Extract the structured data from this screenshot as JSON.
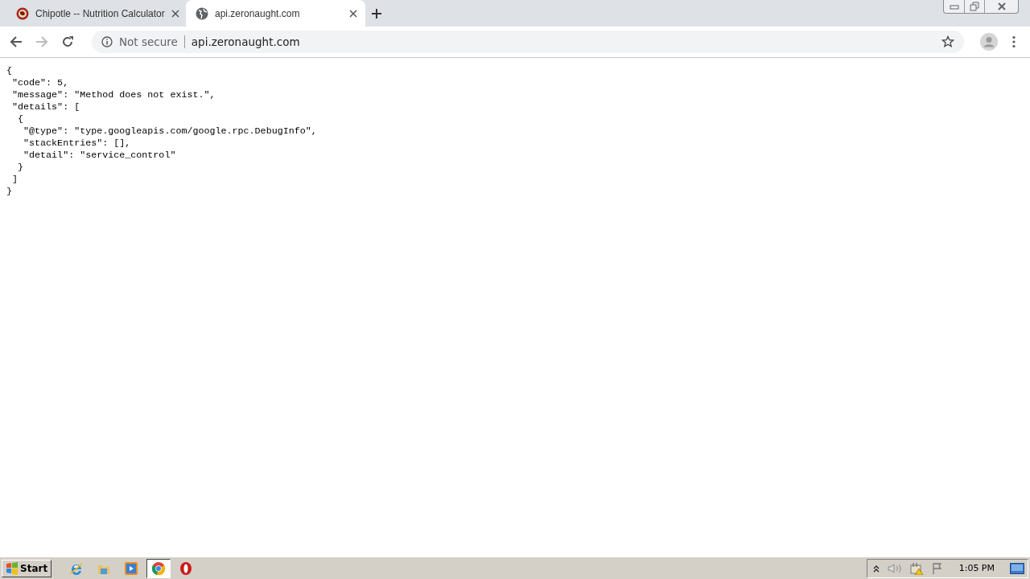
{
  "tabs": [
    {
      "title": "Chipotle -- Nutrition Calculator",
      "kind": "chipotle",
      "selected": false
    },
    {
      "title": "api.zeronaught.com",
      "kind": "globe",
      "selected": true
    }
  ],
  "address_bar": {
    "security": "Not secure",
    "url": "api.zeronaught.com"
  },
  "body_lines": [
    "{",
    " \"code\": 5,",
    " \"message\": \"Method does not exist.\",",
    " \"details\": [",
    "  {",
    "   \"@type\": \"type.googleapis.com/google.rpc.DebugInfo\",",
    "   \"stackEntries\": [],",
    "   \"detail\": \"service_control\"",
    "  }",
    " ]",
    "}"
  ],
  "taskbar": {
    "start": "Start",
    "apps": [
      {
        "kind": "ie",
        "selected": false
      },
      {
        "kind": "explorer",
        "selected": false
      },
      {
        "kind": "media",
        "selected": false
      },
      {
        "kind": "chrome",
        "selected": true
      },
      {
        "kind": "opera",
        "selected": false
      }
    ],
    "clock": "1:05 PM"
  }
}
